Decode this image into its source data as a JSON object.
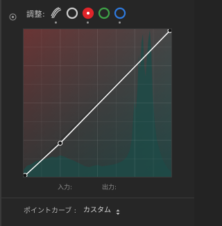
{
  "header": {
    "adjust_label": "調整:",
    "target_tool_icon": "target-adjust-icon",
    "channels": [
      {
        "name": "parametric",
        "icon": "parametric-curve-icon"
      },
      {
        "name": "rgb",
        "color": "#cfcfcf",
        "icon": "rgb-channel-icon"
      },
      {
        "name": "red",
        "color": "#e0252a",
        "icon": "red-channel-icon"
      },
      {
        "name": "green",
        "color": "#3fa548",
        "icon": "green-channel-icon"
      },
      {
        "name": "blue",
        "color": "#2f7be0",
        "icon": "blue-channel-icon"
      }
    ]
  },
  "curve": {
    "control_points": [
      {
        "input": 0,
        "output": 0
      },
      {
        "input": 25,
        "output": 23
      },
      {
        "input": 100,
        "output": 100
      }
    ],
    "input_label": "入力:",
    "output_label": "出力:",
    "input_value": "",
    "output_value": ""
  },
  "footer": {
    "point_curve_label": "ポイントカーブ :",
    "point_curve_value": "カスタム"
  },
  "colors": {
    "panel_bg": "#262626",
    "curve_line": "#ffffff",
    "histogram": "#1f4a47"
  }
}
